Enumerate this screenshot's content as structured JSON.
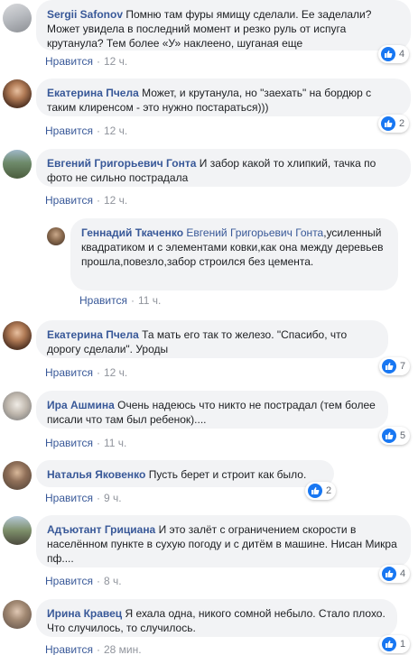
{
  "like_label": "Нравится",
  "comments": [
    {
      "author": "Sergii Safonov",
      "text": "Помню там фуры ямищу сделали. Ее заделали? Может увидела в последний момент и резко руль от испуга крутанула? Тем более «У» наклеено, шуганая еще",
      "time": "12 ч.",
      "likes": "4"
    },
    {
      "author": "Екатерина Пчела",
      "text": "Может, и крутанула, но \"заехать\" на бордюр с таким клиренсом - это нужно постараться)))",
      "time": "12 ч.",
      "likes": "2"
    },
    {
      "author": "Евгений Григорьевич Гонта",
      "text": "И забор какой то хлипкий, тачка по фото не сильно пострадала",
      "time": "12 ч.",
      "likes": ""
    },
    {
      "author": "Геннадий Ткаченко",
      "mention": "Евгений Григорьевич Гонта",
      "text": ",усиленный квадратиком и с элементами ковки,как она между деревьев прошла,повезло,забор строился без цемента.",
      "time": "11 ч.",
      "likes": ""
    },
    {
      "author": "Екатерина Пчела",
      "text": "Та мать его так то железо. \"Спасибо, что дорогу сделали\". Уроды",
      "time": "12 ч.",
      "likes": "7"
    },
    {
      "author": "Ира Ашмина",
      "text": "Очень надеюсь что никто не пострадал (тем более писали что там был ребенок)....",
      "time": "11 ч.",
      "likes": "5"
    },
    {
      "author": "Наталья Яковенко",
      "text": "Пусть берет и строит как было.",
      "time": "9 ч.",
      "likes": "2"
    },
    {
      "author": "Адъютант Грициана",
      "text": "И это залёт с ограничением скорости в населённом пункте в сухую погоду и с дитём в машине. Нисан Микра пф....",
      "time": "8 ч.",
      "likes": "4"
    },
    {
      "author": "Ирина Кравец",
      "text": "Я ехала одна, никого сомной небыло. Стало плохо. Что случилось, то случилось.",
      "time": "28 мин.",
      "likes": "1"
    }
  ],
  "colors": {
    "link": "#385898",
    "bubble": "#f2f3f5",
    "like": "#1877f2",
    "meta": "#90949c"
  }
}
